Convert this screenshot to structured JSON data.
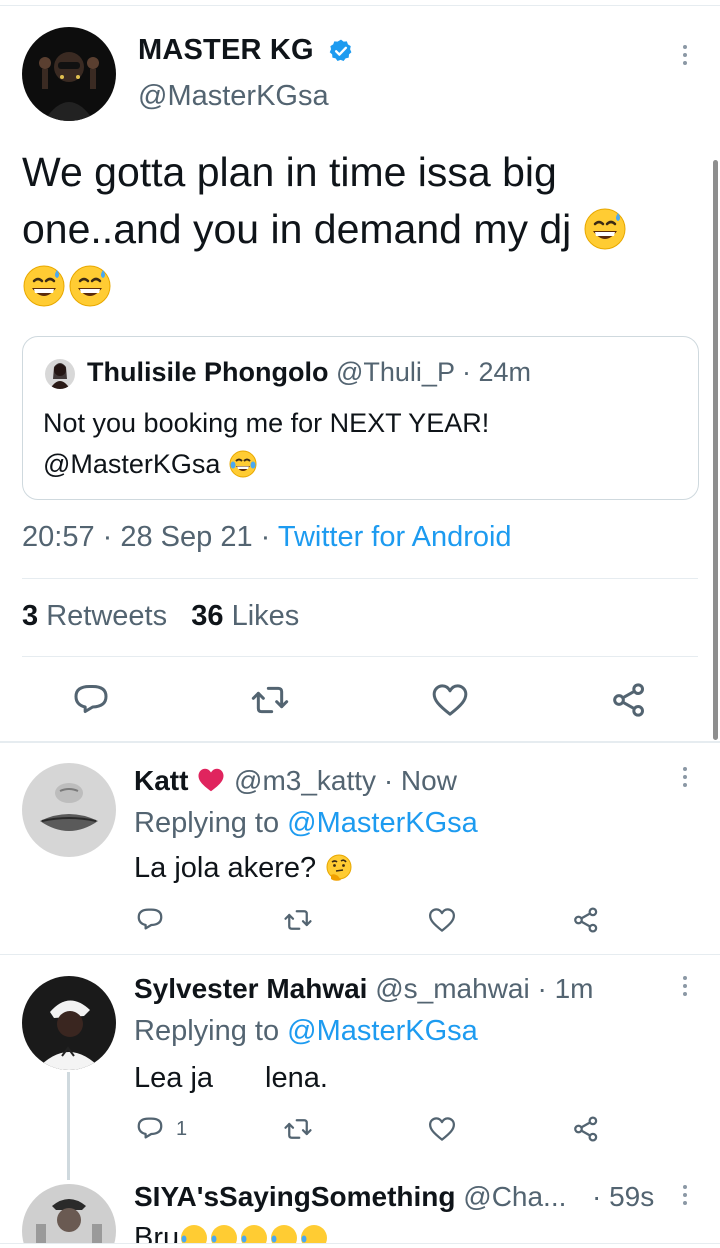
{
  "tweet": {
    "author_name": "MASTER KG",
    "author_handle": "@MasterKGsa",
    "text_line1": "We gotta plan in time issa big",
    "text_line2": "one..and you in demand my dj",
    "emojis": [
      "grinning-sweat-emoji",
      "grinning-sweat-emoji",
      "grinning-sweat-emoji"
    ],
    "quote": {
      "author_name": "Thulisile Phongolo",
      "author_handle": "@Thuli_P",
      "time": "· 24m",
      "text_line1": "Not you booking me for NEXT YEAR!",
      "text_line2": "@MasterKGsa"
    },
    "timestamp": "20:57 · 28 Sep 21 ·",
    "source": "Twitter for Android",
    "retweets_count": "3",
    "retweets_label": "Retweets",
    "likes_count": "36",
    "likes_label": "Likes"
  },
  "replies": [
    {
      "name": "Katt",
      "handle": "@m3_katty",
      "time": "· Now",
      "replying_label": "Replying to",
      "replying_to": "@MasterKGsa",
      "text": "La jola akere?",
      "reply_count": ""
    },
    {
      "name": "Sylvester Mahwai",
      "handle": "@s_mahwai",
      "time": "· 1m",
      "replying_label": "Replying to",
      "replying_to": "@MasterKGsa",
      "text_start": "Lea ja",
      "text_end": "lena.",
      "reply_count": "1"
    },
    {
      "name": "SIYA'sSayingSomething",
      "handle": "@Cha...",
      "time": "· 59s",
      "text": "Bru"
    }
  ],
  "colors": {
    "accent": "#1d9bf0",
    "muted": "#536471",
    "like_heart": "#e0245e"
  }
}
